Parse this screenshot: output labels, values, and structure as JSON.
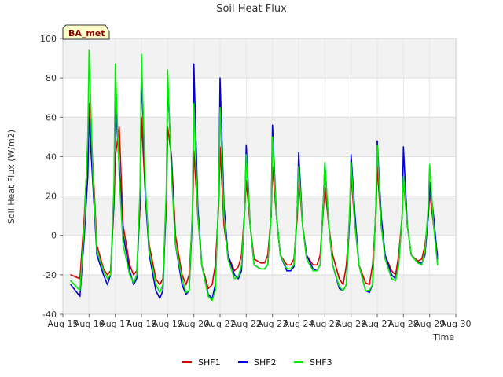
{
  "chart_data": {
    "type": "line",
    "title": "Soil Heat Flux",
    "xlabel": "Time",
    "ylabel": "Soil Heat Flux (W/m2)",
    "badge": "BA_met",
    "xlim": [
      15,
      30
    ],
    "ylim": [
      -40,
      100
    ],
    "x_tick_values": [
      15,
      16,
      17,
      18,
      19,
      20,
      21,
      22,
      23,
      24,
      25,
      26,
      27,
      28,
      29,
      30
    ],
    "x_tick_labels": [
      "Aug 15",
      "Aug 16",
      "Aug 17",
      "Aug 18",
      "Aug 19",
      "Aug 20",
      "Aug 21",
      "Aug 22",
      "Aug 23",
      "Aug 24",
      "Aug 25",
      "Aug 26",
      "Aug 27",
      "Aug 28",
      "Aug 29",
      "Aug 30"
    ],
    "y_tick_values": [
      -40,
      -20,
      0,
      20,
      40,
      60,
      80,
      100
    ],
    "y_tick_labels": [
      "-40",
      "-20",
      "0",
      "20",
      "40",
      "60",
      "80",
      "100"
    ],
    "grid": true,
    "legend_position": "bottom-center",
    "series": [
      {
        "name": "SHF1",
        "color": "#dd0000",
        "x": [
          15.3,
          15.65,
          15.82,
          15.95,
          16.0,
          16.15,
          16.3,
          16.55,
          16.7,
          16.82,
          16.95,
          17.0,
          17.15,
          17.3,
          17.55,
          17.7,
          17.82,
          17.95,
          18.0,
          18.15,
          18.3,
          18.55,
          18.7,
          18.82,
          18.95,
          19.0,
          19.15,
          19.3,
          19.55,
          19.7,
          19.82,
          19.95,
          20.0,
          20.15,
          20.3,
          20.55,
          20.7,
          20.82,
          20.95,
          21.0,
          21.15,
          21.3,
          21.55,
          21.7,
          21.82,
          21.95,
          22.0,
          22.15,
          22.3,
          22.55,
          22.7,
          22.82,
          22.95,
          23.0,
          23.15,
          23.3,
          23.55,
          23.7,
          23.82,
          23.95,
          24.0,
          24.15,
          24.3,
          24.55,
          24.7,
          24.82,
          24.95,
          25.0,
          25.15,
          25.3,
          25.55,
          25.7,
          25.82,
          25.95,
          26.0,
          26.15,
          26.3,
          26.55,
          26.7,
          26.82,
          26.95,
          27.0,
          27.15,
          27.3,
          27.55,
          27.7,
          27.82,
          27.95,
          28.0,
          28.15,
          28.3,
          28.55,
          28.7,
          28.82,
          28.95,
          29.0,
          29.15,
          29.3
        ],
        "y": [
          -20,
          -22,
          10,
          45,
          67,
          35,
          -5,
          -17,
          -20,
          -18,
          15,
          40,
          55,
          5,
          -15,
          -20,
          -18,
          15,
          60,
          20,
          -5,
          -22,
          -25,
          -22,
          15,
          55,
          40,
          0,
          -20,
          -25,
          -20,
          10,
          43,
          10,
          -15,
          -27,
          -25,
          -15,
          15,
          45,
          5,
          -10,
          -18,
          -16,
          -10,
          15,
          28,
          5,
          -12,
          -14,
          -14,
          -10,
          10,
          35,
          10,
          -10,
          -15,
          -15,
          -12,
          10,
          30,
          5,
          -10,
          -15,
          -15,
          -10,
          15,
          25,
          5,
          -10,
          -22,
          -25,
          -15,
          10,
          30,
          5,
          -15,
          -24,
          -25,
          -15,
          10,
          35,
          5,
          -10,
          -18,
          -20,
          -10,
          10,
          28,
          5,
          -10,
          -13,
          -12,
          -5,
          10,
          22,
          5,
          -10
        ]
      },
      {
        "name": "SHF2",
        "color": "#0000dd",
        "x": [
          15.3,
          15.65,
          15.82,
          15.95,
          16.0,
          16.15,
          16.3,
          16.55,
          16.7,
          16.82,
          16.95,
          17.0,
          17.15,
          17.3,
          17.55,
          17.7,
          17.82,
          17.95,
          18.0,
          18.15,
          18.3,
          18.55,
          18.7,
          18.82,
          18.95,
          19.0,
          19.15,
          19.3,
          19.55,
          19.7,
          19.82,
          19.95,
          20.0,
          20.15,
          20.3,
          20.55,
          20.7,
          20.82,
          20.95,
          21.0,
          21.15,
          21.3,
          21.55,
          21.7,
          21.82,
          21.95,
          22.0,
          22.15,
          22.3,
          22.55,
          22.7,
          22.82,
          22.95,
          23.0,
          23.15,
          23.3,
          23.55,
          23.7,
          23.82,
          23.95,
          24.0,
          24.15,
          24.3,
          24.55,
          24.7,
          24.82,
          24.95,
          25.0,
          25.15,
          25.3,
          25.55,
          25.7,
          25.82,
          25.95,
          26.0,
          26.15,
          26.3,
          26.55,
          26.7,
          26.82,
          26.95,
          27.0,
          27.15,
          27.3,
          27.55,
          27.7,
          27.82,
          27.95,
          28.0,
          28.15,
          28.3,
          28.55,
          28.7,
          28.82,
          28.95,
          29.0,
          29.15,
          29.3
        ],
        "y": [
          -25,
          -31,
          0,
          30,
          60,
          25,
          -10,
          -20,
          -25,
          -20,
          20,
          70,
          35,
          0,
          -18,
          -25,
          -22,
          20,
          86,
          20,
          -10,
          -28,
          -32,
          -28,
          20,
          78,
          35,
          -5,
          -25,
          -30,
          -28,
          10,
          87,
          15,
          -15,
          -30,
          -32,
          -25,
          20,
          80,
          15,
          -10,
          -20,
          -22,
          -18,
          15,
          46,
          5,
          -15,
          -17,
          -17,
          -15,
          10,
          56,
          10,
          -10,
          -18,
          -18,
          -16,
          15,
          42,
          5,
          -10,
          -17,
          -18,
          -15,
          20,
          37,
          5,
          -15,
          -27,
          -28,
          -25,
          10,
          41,
          10,
          -15,
          -28,
          -29,
          -25,
          15,
          48,
          10,
          -10,
          -20,
          -22,
          -15,
          10,
          45,
          5,
          -10,
          -14,
          -14,
          -10,
          10,
          27,
          10,
          -12
        ]
      },
      {
        "name": "SHF3",
        "color": "#00ee00",
        "x": [
          15.3,
          15.65,
          15.82,
          15.95,
          16.0,
          16.15,
          16.3,
          16.55,
          16.7,
          16.82,
          16.95,
          17.0,
          17.15,
          17.3,
          17.55,
          17.7,
          17.82,
          17.95,
          18.0,
          18.15,
          18.3,
          18.55,
          18.7,
          18.82,
          18.95,
          19.0,
          19.15,
          19.3,
          19.55,
          19.7,
          19.82,
          19.95,
          20.0,
          20.15,
          20.3,
          20.55,
          20.7,
          20.82,
          20.95,
          21.0,
          21.15,
          21.3,
          21.55,
          21.7,
          21.82,
          21.95,
          22.0,
          22.15,
          22.3,
          22.55,
          22.7,
          22.82,
          22.95,
          23.0,
          23.15,
          23.3,
          23.55,
          23.7,
          23.82,
          23.95,
          24.0,
          24.15,
          24.3,
          24.55,
          24.7,
          24.82,
          24.95,
          25.0,
          25.15,
          25.3,
          25.55,
          25.7,
          25.82,
          25.95,
          26.0,
          26.15,
          26.3,
          26.55,
          26.7,
          26.82,
          26.95,
          27.0,
          27.15,
          27.3,
          27.55,
          27.7,
          27.82,
          27.95,
          28.0,
          28.15,
          28.3,
          28.55,
          28.7,
          28.82,
          28.95,
          29.0,
          29.15,
          29.3
        ],
        "y": [
          -23,
          -28,
          5,
          50,
          94,
          30,
          -8,
          -18,
          -22,
          -20,
          25,
          87,
          30,
          -5,
          -20,
          -24,
          -20,
          25,
          92,
          25,
          -8,
          -25,
          -29,
          -25,
          25,
          84,
          30,
          -5,
          -22,
          -29,
          -28,
          15,
          67,
          10,
          -15,
          -31,
          -33,
          -28,
          20,
          65,
          10,
          -12,
          -22,
          -21,
          -15,
          15,
          41,
          5,
          -15,
          -17,
          -17,
          -15,
          10,
          50,
          10,
          -10,
          -17,
          -17,
          -15,
          15,
          35,
          5,
          -12,
          -18,
          -18,
          -15,
          20,
          37,
          5,
          -15,
          -26,
          -28,
          -25,
          15,
          37,
          5,
          -15,
          -28,
          -28,
          -25,
          15,
          46,
          5,
          -12,
          -22,
          -23,
          -15,
          10,
          30,
          5,
          -10,
          -14,
          -15,
          -8,
          15,
          36,
          5,
          -15
        ]
      }
    ]
  }
}
